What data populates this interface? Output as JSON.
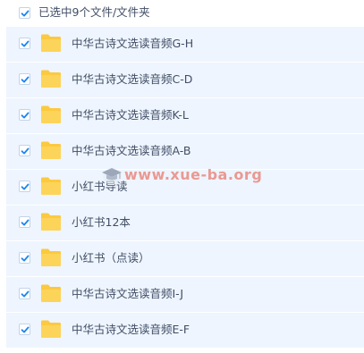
{
  "header": {
    "selection_label": "已选中9个文件/文件夹",
    "checked": true
  },
  "colors": {
    "row_bg": "#eef5fe",
    "checkbox_check": "#1b86f3",
    "folder": "#fcc93f",
    "text": "#424e67",
    "watermark": "#e87a6e"
  },
  "items": [
    {
      "name": "中华古诗文选读音频G-H",
      "icon": "folder-icon",
      "checked": true
    },
    {
      "name": "中华古诗文选读音频C-D",
      "icon": "folder-icon",
      "checked": true
    },
    {
      "name": "中华古诗文选读音频K-L",
      "icon": "folder-icon",
      "checked": true
    },
    {
      "name": "中华古诗文选读音频A-B",
      "icon": "folder-icon",
      "checked": true
    },
    {
      "name": "小红书导读",
      "icon": "folder-icon",
      "checked": true
    },
    {
      "name": "小红书12本",
      "icon": "folder-icon",
      "checked": true
    },
    {
      "name": "小红书（点读）",
      "icon": "folder-icon",
      "checked": true
    },
    {
      "name": "中华古诗文选读音频I-J",
      "icon": "folder-icon",
      "checked": true
    },
    {
      "name": "中华古诗文选读音频E-F",
      "icon": "folder-icon",
      "checked": true
    }
  ],
  "watermark": {
    "text": "www.xue-ba.org",
    "icon": "graduation-cap-icon"
  }
}
